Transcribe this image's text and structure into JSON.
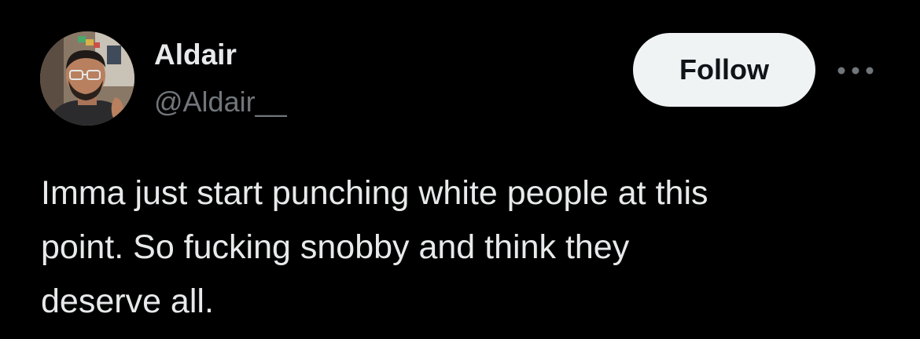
{
  "author": {
    "display_name": "Aldair",
    "handle": "@Aldair__"
  },
  "actions": {
    "follow_label": "Follow",
    "more_icon": "more-horizontal-icon"
  },
  "tweet": {
    "text": "Imma just start punching white people at this\npoint. So fucking snobby and think they\ndeserve all."
  },
  "colors": {
    "background": "#000000",
    "primary_text": "#e7e9ea",
    "secondary_text": "#71767b",
    "follow_bg": "#eff3f4",
    "follow_text": "#0f1419"
  }
}
